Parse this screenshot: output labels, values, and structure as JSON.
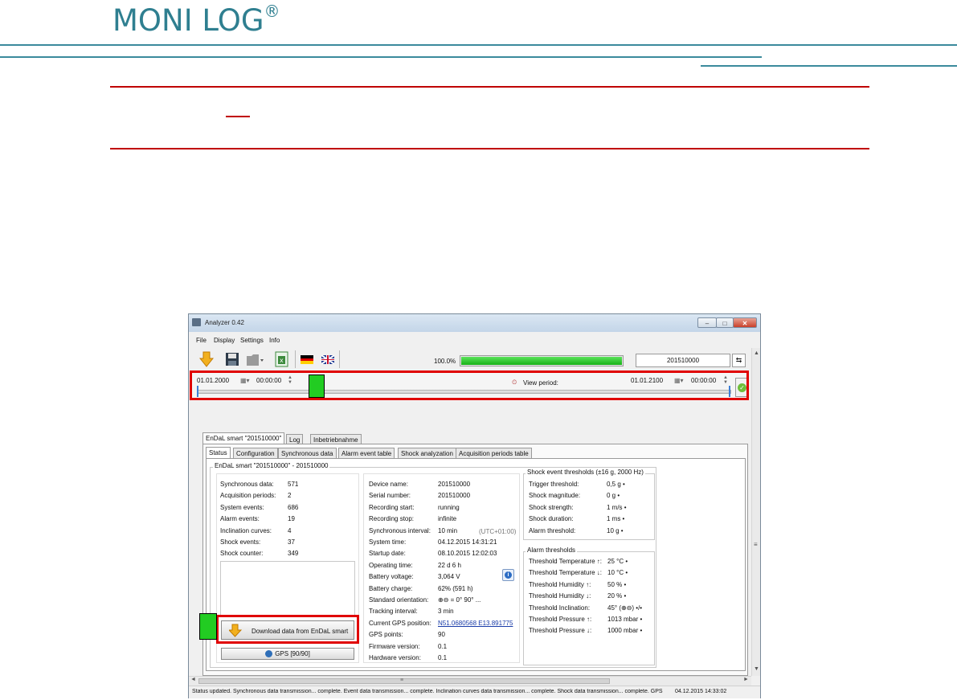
{
  "page": {
    "logo_text": "MONI LOG",
    "logo_mark": "®"
  },
  "window": {
    "title": "Analyzer 0.42",
    "controls": {
      "minimize": "–",
      "maximize": "□",
      "close": "✕"
    }
  },
  "menu": [
    "File",
    "Display",
    "Settings",
    "Info"
  ],
  "toolbar": {
    "progress_text": "100.0%",
    "progress_fraction": 1.0,
    "device_field": "201510000",
    "icons": [
      "download-arrow-icon",
      "save-disk-icon",
      "open-folder-icon",
      "excel-export-icon",
      "german-flag-icon",
      "uk-flag-icon",
      "usb-icon"
    ]
  },
  "period": {
    "start_date": "01.01.2000",
    "start_time": "00:00:00",
    "label": "View period:",
    "end_date": "01.01.2100",
    "end_time": "00:00:00"
  },
  "device_tabs": [
    "EnDaL smart \"201510000\"",
    "Log",
    "Inbetriebnahme"
  ],
  "sub_tabs": [
    "Status",
    "Configuration",
    "Synchronous data",
    "Alarm event table",
    "Shock analyzation",
    "Acquisition periods table"
  ],
  "status": {
    "group_title": "EnDaL smart \"201510000\" - 201510000",
    "counts": [
      {
        "label": "Synchronous data:",
        "value": "571"
      },
      {
        "label": "Acquisition periods:",
        "value": "2"
      },
      {
        "label": "System events:",
        "value": "686"
      },
      {
        "label": "Alarm events:",
        "value": "19"
      },
      {
        "label": "Inclination curves:",
        "value": "4"
      },
      {
        "label": "Shock events:",
        "value": "37"
      },
      {
        "label": "Shock counter:",
        "value": "349"
      }
    ],
    "download_button": "Download data from EnDaL smart",
    "gps_button": "GPS [90/90]",
    "device_info": [
      {
        "label": "Device name:",
        "value": "201510000"
      },
      {
        "label": "Serial number:",
        "value": "201510000"
      },
      {
        "label": "Recording start:",
        "value": "running"
      },
      {
        "label": "Recording stop:",
        "value": "infinite"
      },
      {
        "label": "Synchronous interval:",
        "value": "10 min"
      },
      {
        "label": "System time:",
        "value": "04.12.2015 14:31:21"
      },
      {
        "label": "Startup date:",
        "value": "08.10.2015 12:02:03"
      },
      {
        "label": "Operating time:",
        "value": "22 d 6 h"
      },
      {
        "label": "Battery voltage:",
        "value": "3,064 V"
      },
      {
        "label": "Battery charge:",
        "value": "62%  (591 h)"
      },
      {
        "label": "Standard orientation:",
        "value": "⊕⊖ = 0° 90° ..."
      },
      {
        "label": "Tracking interval:",
        "value": "3 min"
      },
      {
        "label": "Current GPS position:",
        "value": "N51.0680568 E13.891775"
      },
      {
        "label": "GPS points:",
        "value": "90"
      },
      {
        "label": "Firmware version:",
        "value": "0.1"
      },
      {
        "label": "Hardware version:",
        "value": "0.1"
      }
    ],
    "utc_note": "(UTC+01:00)",
    "shock_group_title": "Shock event thresholds (±16 g, 2000 Hz)",
    "shock_thresholds": [
      {
        "label": "Trigger threshold:",
        "value": "0,5 g •"
      },
      {
        "label": "Shock magnitude:",
        "value": "0 g •"
      },
      {
        "label": "Shock strength:",
        "value": "1 m/s •"
      },
      {
        "label": "Shock duration:",
        "value": "1 ms •"
      },
      {
        "label": "Alarm threshold:",
        "value": "10 g •"
      }
    ],
    "alarm_group_title": "Alarm thresholds",
    "alarm_thresholds": [
      {
        "label": "Threshold Temperature ↑:",
        "value": "25 °C •"
      },
      {
        "label": "Threshold Temperature ↓:",
        "value": "10 °C •"
      },
      {
        "label": "Threshold Humidity ↑:",
        "value": "50 % •"
      },
      {
        "label": "Threshold Humidity ↓:",
        "value": "20 % •"
      },
      {
        "label": "Threshold Inclination:",
        "value": "45° (⊕⊖) •/•"
      },
      {
        "label": "Threshold Pressure ↑:",
        "value": "1013 mbar •"
      },
      {
        "label": "Threshold Pressure ↓:",
        "value": "1000 mbar •"
      }
    ]
  },
  "statusbar": {
    "message": "Status updated. Synchronous data transmission... complete. Event data transmission... complete. Inclination curves data transmission... complete. Shock data transmission... complete. GPS",
    "timestamp": "04.12.2015 14:33:02"
  },
  "colors": {
    "brand": "#2f7f90",
    "highlight": "#e00000",
    "marker": "#22cc22",
    "progress": "#17b217"
  }
}
